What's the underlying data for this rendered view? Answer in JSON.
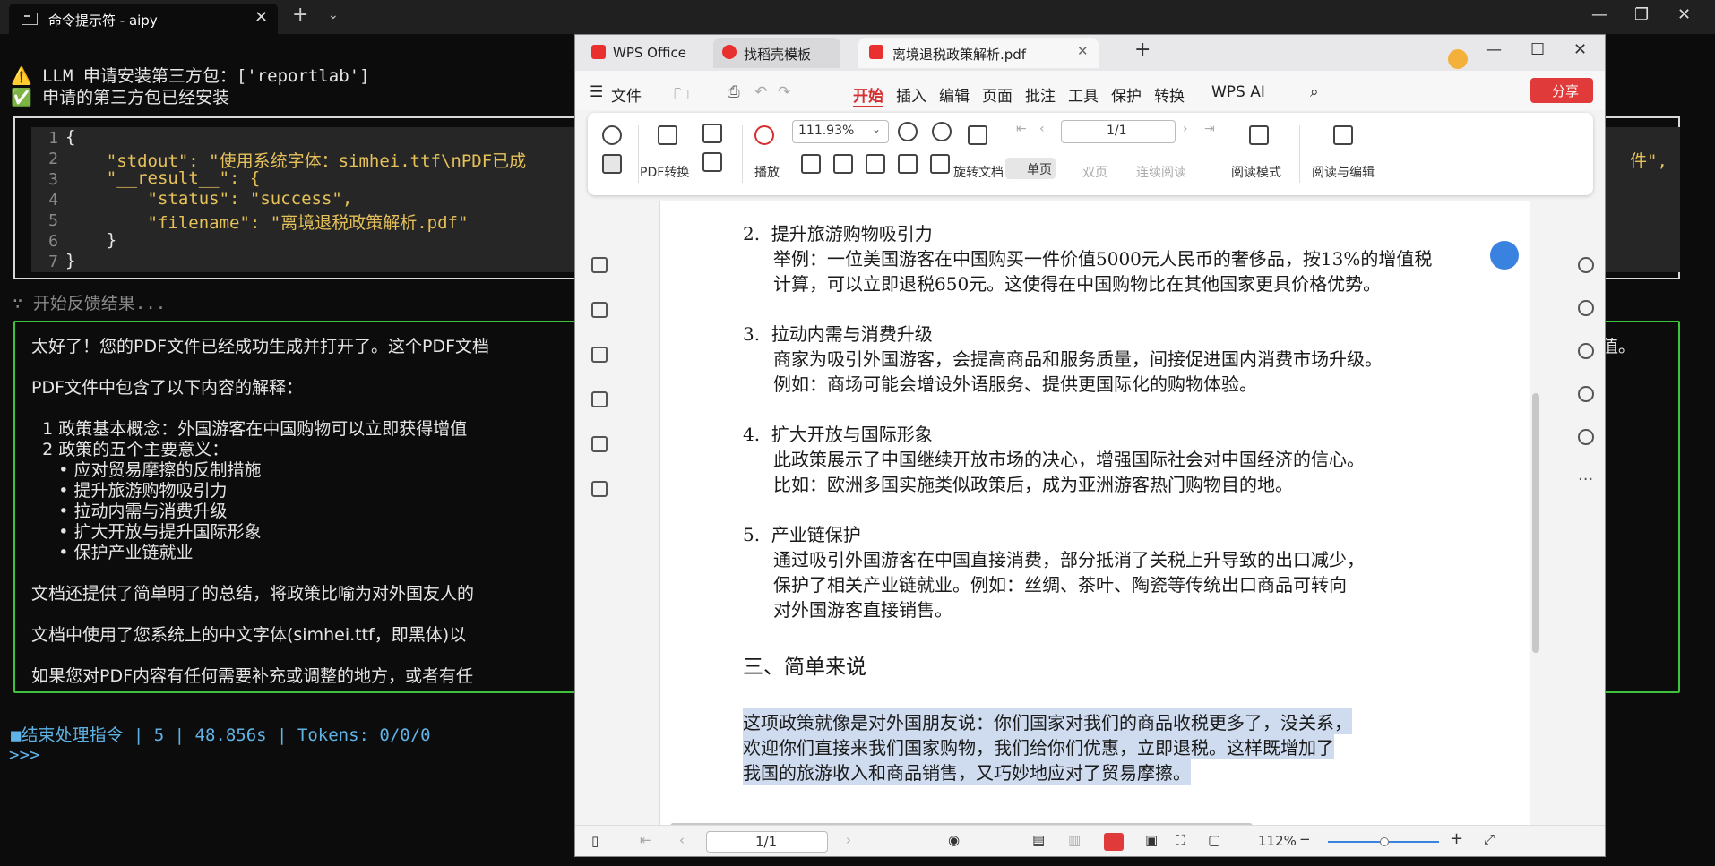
{
  "terminal": {
    "tab_title": "命令提示符 - aipy",
    "line1": "⚠️ LLM 申请安装第三方包：['reportlab']",
    "line2": "✅ 申请的第三方包已经安装",
    "code_lines": [
      {
        "n": "1",
        "text": "{"
      },
      {
        "n": "2",
        "text": "    \"stdout\": \"使用系统字体：simhei.ttf\\nPDF已成"
      },
      {
        "n": "3",
        "text": "    \"__result__\": {"
      },
      {
        "n": "4",
        "text": "        \"status\": \"success\","
      },
      {
        "n": "5",
        "text": "        \"filename\": \"离境退税政策解析.pdf\""
      },
      {
        "n": "6",
        "text": "    }"
      },
      {
        "n": "7",
        "text": "}"
      }
    ],
    "code_tail": "件\",",
    "feedback_head": "∵ 开始反馈结果...",
    "result_lines": [
      "太好了！您的PDF文件已经成功生成并打开了。这个PDF文档",
      "PDF文件中包含了以下内容的解释：",
      "  1 政策基本概念：外国游客在中国购物可以立即获得增值",
      "  2 政策的五个主要意义：",
      "     • 应对贸易摩擦的反制措施",
      "     • 提升旅游购物吸引力",
      "     • 拉动内需与消费升级",
      "     • 扩大开放与提升国际形象",
      "     • 保护产业链就业",
      "文档还提供了简单明了的总结，将政策比喻为对外国友人的",
      "文档中使用了您系统上的中文字体(simhei.ttf，即黑体)以",
      "如果您对PDF内容有任何需要补充或调整的地方，或者有任"
    ],
    "result_tail": "值。",
    "status_line": "■结束处理指令 | 5 | 48.856s | Tokens: 0/0/0",
    "prompt": ">>>"
  },
  "wps": {
    "tabs": [
      "WPS Office",
      "找稻壳模板",
      "离境退税政策解析.pdf"
    ],
    "menu": [
      "文件",
      "开始",
      "插入",
      "编辑",
      "页面",
      "批注",
      "工具",
      "保护",
      "转换",
      "WPS AI"
    ],
    "share": "分享",
    "toolbar": {
      "pdf_convert": "PDF转换",
      "play": "播放",
      "zoom": "111.93%",
      "rotate": "旋转文档",
      "single": "单页",
      "double": "双页",
      "continuous": "连续阅读",
      "page": "1/1",
      "read_mode": "阅读模式",
      "read_edit": "阅读与编辑"
    },
    "doc": {
      "s2_title": "2.  提升旅游购物吸引力",
      "s2_l1": "举例：一位美国游客在中国购买一件价值5000元人民币的奢侈品，按13%的增值税",
      "s2_l2": "计算，可以立即退税650元。这使得在中国购物比在其他国家更具价格优势。",
      "s3_title": "3.  拉动内需与消费升级",
      "s3_l1": "商家为吸引外国游客，会提高商品和服务质量，间接促进国内消费市场升级。",
      "s3_l2": "例如：商场可能会增设外语服务、提供更国际化的购物体验。",
      "s4_title": "4.  扩大开放与国际形象",
      "s4_l1": "此政策展示了中国继续开放市场的决心，增强国际社会对中国经济的信心。",
      "s4_l2": "比如：欧洲多国实施类似政策后，成为亚洲游客热门购物目的地。",
      "s5_title": "5.  产业链保护",
      "s5_l1": "通过吸引外国游客在中国直接消费，部分抵消了关税上升导致的出口减少，",
      "s5_l2": "保护了相关产业链就业。例如：丝绸、茶叶、陶瓷等传统出口商品可转向",
      "s5_l3": "对外国游客直接销售。",
      "h3": "三、简单来说",
      "p1": "这项政策就像是对外国朋友说：你们国家对我们的商品收税更多了，没关系，",
      "p2": "欢迎你们直接来我们国家购物，我们给你们优惠，立即退税。这样既增加了",
      "p3": "我国的旅游收入和商品销售，又巧妙地应对了贸易摩擦。"
    },
    "status": {
      "page": "1/1",
      "zoom": "112%"
    }
  }
}
